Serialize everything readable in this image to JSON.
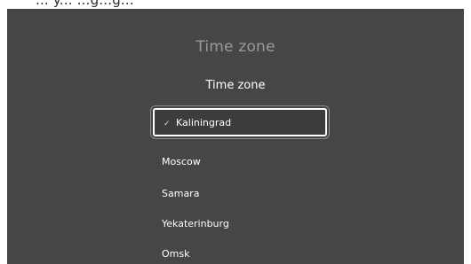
{
  "background_text": "... y... ...g...g...",
  "header": {
    "title": "Time zone"
  },
  "list": {
    "title": "Time zone",
    "items": [
      {
        "label": "Kaliningrad",
        "selected": true
      },
      {
        "label": "Moscow",
        "selected": false
      },
      {
        "label": "Samara",
        "selected": false
      },
      {
        "label": "Yekaterinburg",
        "selected": false
      },
      {
        "label": "Omsk",
        "selected": false
      }
    ]
  },
  "icons": {
    "selected_marker": "check-icon"
  },
  "colors": {
    "panel_background": "#464646",
    "selected_background": "#3c3c3c",
    "header_text": "#9a9a9a",
    "item_text": "#ffffff"
  }
}
